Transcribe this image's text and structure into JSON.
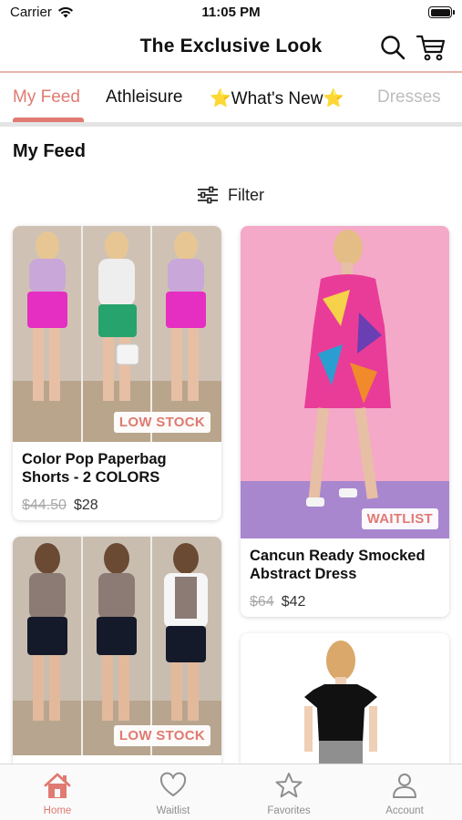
{
  "status_bar": {
    "carrier": "Carrier",
    "time": "11:05 PM"
  },
  "header": {
    "title": "The Exclusive Look"
  },
  "tabs": [
    {
      "label": "My Feed",
      "active": true
    },
    {
      "label": "Athleisure"
    },
    {
      "label": "⭐What's New⭐"
    },
    {
      "label": "Dresses"
    }
  ],
  "section": {
    "title": "My Feed",
    "filter_label": "Filter"
  },
  "products": [
    {
      "title": "Color Pop Paperbag Shorts - 2 COLORS",
      "old_price": "$44.50",
      "price": "$28",
      "badge": "LOW STOCK"
    },
    {
      "title": "Cancun Ready Smocked Abstract Dress",
      "old_price": "$64",
      "price": "$42",
      "badge": "WAITLIST"
    },
    {
      "title": "",
      "old_price": "",
      "price": "",
      "badge": "LOW STOCK"
    },
    {
      "title": "",
      "old_price": "",
      "price": "",
      "badge": ""
    }
  ],
  "bottom_nav": [
    {
      "label": "Home",
      "icon": "home-icon",
      "active": true
    },
    {
      "label": "Waitlist",
      "icon": "heart-icon"
    },
    {
      "label": "Favorites",
      "icon": "star-icon"
    },
    {
      "label": "Account",
      "icon": "person-icon"
    }
  ],
  "colors": {
    "accent": "#e07a72",
    "divider": "#e7b3ad",
    "inactive": "#8e8e8e"
  }
}
